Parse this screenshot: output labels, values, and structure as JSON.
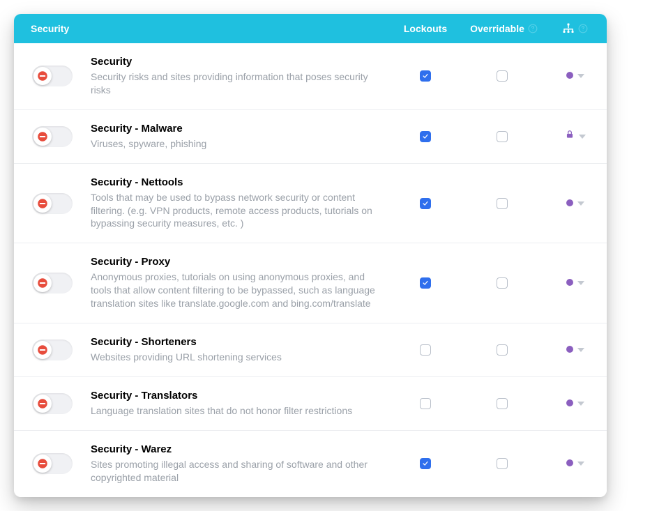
{
  "header": {
    "title": "Security",
    "lockouts_label": "Lockouts",
    "overridable_label": "Overridable"
  },
  "categories": [
    {
      "title": "Security",
      "desc": "Security risks and sites providing information that poses security risks",
      "lockout": true,
      "overridable": false,
      "action_icon": "dot"
    },
    {
      "title": "Security - Malware",
      "desc": "Viruses, spyware, phishing",
      "lockout": true,
      "overridable": false,
      "action_icon": "lock"
    },
    {
      "title": "Security - Nettools",
      "desc": "Tools that may be used to bypass network security or content filtering. (e.g. VPN products, remote access products, tutorials on bypassing security measures, etc. )",
      "lockout": true,
      "overridable": false,
      "action_icon": "dot"
    },
    {
      "title": "Security - Proxy",
      "desc": "Anonymous proxies, tutorials on using anonymous proxies, and tools that allow content filtering to be bypassed, such as language translation sites like translate.google.com and bing.com/translate",
      "lockout": true,
      "overridable": false,
      "action_icon": "dot"
    },
    {
      "title": "Security - Shorteners",
      "desc": "Websites providing URL shortening services",
      "lockout": false,
      "overridable": false,
      "action_icon": "dot"
    },
    {
      "title": "Security - Translators",
      "desc": "Language translation sites that do not honor filter restrictions",
      "lockout": false,
      "overridable": false,
      "action_icon": "dot"
    },
    {
      "title": "Security - Warez",
      "desc": "Sites promoting illegal access and sharing of software and other copyrighted material",
      "lockout": true,
      "overridable": false,
      "action_icon": "dot"
    }
  ]
}
